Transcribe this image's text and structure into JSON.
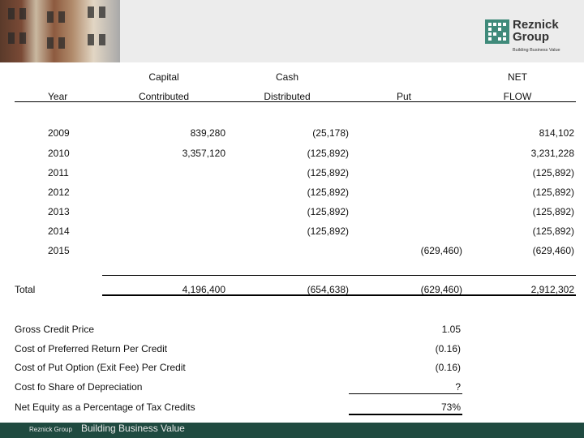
{
  "header": {
    "logo_name": "Reznick Group",
    "logo_tagline": "Building Business Value"
  },
  "table": {
    "col_headers_top": {
      "capital": "Capital",
      "cash": "Cash",
      "net": "NET"
    },
    "col_headers": {
      "year": "Year",
      "contributed": "Contributed",
      "distributed": "Distributed",
      "put": "Put",
      "flow": "FLOW"
    },
    "rows": [
      {
        "year": "2009",
        "contributed": "839,280",
        "distributed": "(25,178)",
        "put": "",
        "flow": "814,102"
      },
      {
        "year": "2010",
        "contributed": "3,357,120",
        "distributed": "(125,892)",
        "put": "",
        "flow": "3,231,228"
      },
      {
        "year": "2011",
        "contributed": "",
        "distributed": "(125,892)",
        "put": "",
        "flow": "(125,892)"
      },
      {
        "year": "2012",
        "contributed": "",
        "distributed": "(125,892)",
        "put": "",
        "flow": "(125,892)"
      },
      {
        "year": "2013",
        "contributed": "",
        "distributed": "(125,892)",
        "put": "",
        "flow": "(125,892)"
      },
      {
        "year": "2014",
        "contributed": "",
        "distributed": "(125,892)",
        "put": "",
        "flow": "(125,892)"
      },
      {
        "year": "2015",
        "contributed": "",
        "distributed": "",
        "put": "(629,460)",
        "flow": "(629,460)"
      }
    ],
    "total": {
      "label": "Total",
      "contributed": "4,196,400",
      "distributed": "(654,638)",
      "put": "(629,460)",
      "flow": "2,912,302"
    }
  },
  "summary": [
    {
      "label": "Gross Credit Price",
      "value": "1.05"
    },
    {
      "label": "Cost of Preferred Return Per Credit",
      "value": "(0.16)"
    },
    {
      "label": "Cost of Put Option (Exit Fee) Per Credit",
      "value": "(0.16)"
    },
    {
      "label": "Cost fo Share of Depreciation",
      "value": "?"
    },
    {
      "label": "Net Equity as a Percentage of Tax Credits",
      "value": "73%"
    }
  ],
  "footer": {
    "brand": "Reznick Group",
    "tagline": "Building Business Value"
  },
  "colors": {
    "footer_bg": "#1f4a40",
    "logo_green": "#3f8a7a",
    "header_bg": "#ececec"
  }
}
